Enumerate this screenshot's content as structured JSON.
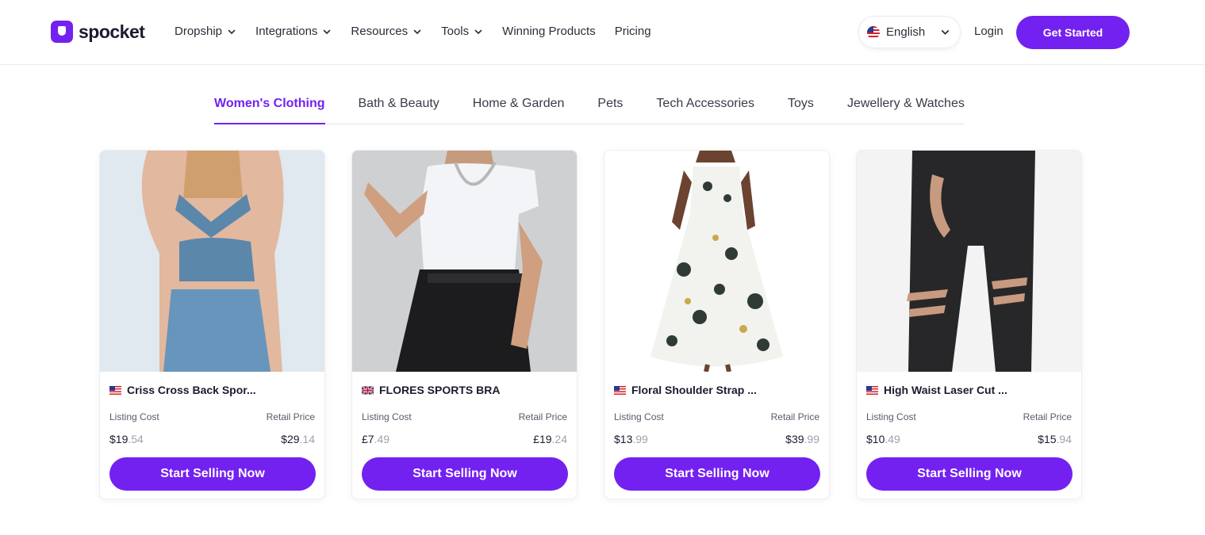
{
  "brand": {
    "name": "spocket",
    "color": "#7321f0"
  },
  "nav": {
    "items": [
      {
        "label": "Dropship",
        "dropdown": true
      },
      {
        "label": "Integrations",
        "dropdown": true
      },
      {
        "label": "Resources",
        "dropdown": true
      },
      {
        "label": "Tools",
        "dropdown": true
      },
      {
        "label": "Winning Products",
        "dropdown": false
      },
      {
        "label": "Pricing",
        "dropdown": false
      }
    ],
    "language": "English",
    "login": "Login",
    "cta": "Get Started"
  },
  "tabs": [
    {
      "label": "Women's Clothing",
      "active": true
    },
    {
      "label": "Bath & Beauty",
      "active": false
    },
    {
      "label": "Home & Garden",
      "active": false
    },
    {
      "label": "Pets",
      "active": false
    },
    {
      "label": "Tech Accessories",
      "active": false
    },
    {
      "label": "Toys",
      "active": false
    },
    {
      "label": "Jewellery & Watches",
      "active": false
    }
  ],
  "labels": {
    "listing_cost": "Listing Cost",
    "retail_price": "Retail Price",
    "button": "Start Selling Now"
  },
  "products": [
    {
      "name": "Criss Cross Back Spor...",
      "flag": "us-flag-icon",
      "listing_main": "$19",
      "listing_cents": ".54",
      "retail_main": "$29",
      "retail_cents": ".14"
    },
    {
      "name": "FLORES SPORTS BRA",
      "flag": "uk-flag-icon",
      "listing_main": "£7",
      "listing_cents": ".49",
      "retail_main": "£19",
      "retail_cents": ".24"
    },
    {
      "name": "Floral Shoulder Strap ...",
      "flag": "us-flag-icon",
      "listing_main": "$13",
      "listing_cents": ".99",
      "retail_main": "$39",
      "retail_cents": ".99"
    },
    {
      "name": "High Waist Laser Cut ...",
      "flag": "us-flag-icon",
      "listing_main": "$10",
      "listing_cents": ".49",
      "retail_main": "$15",
      "retail_cents": ".94"
    }
  ]
}
